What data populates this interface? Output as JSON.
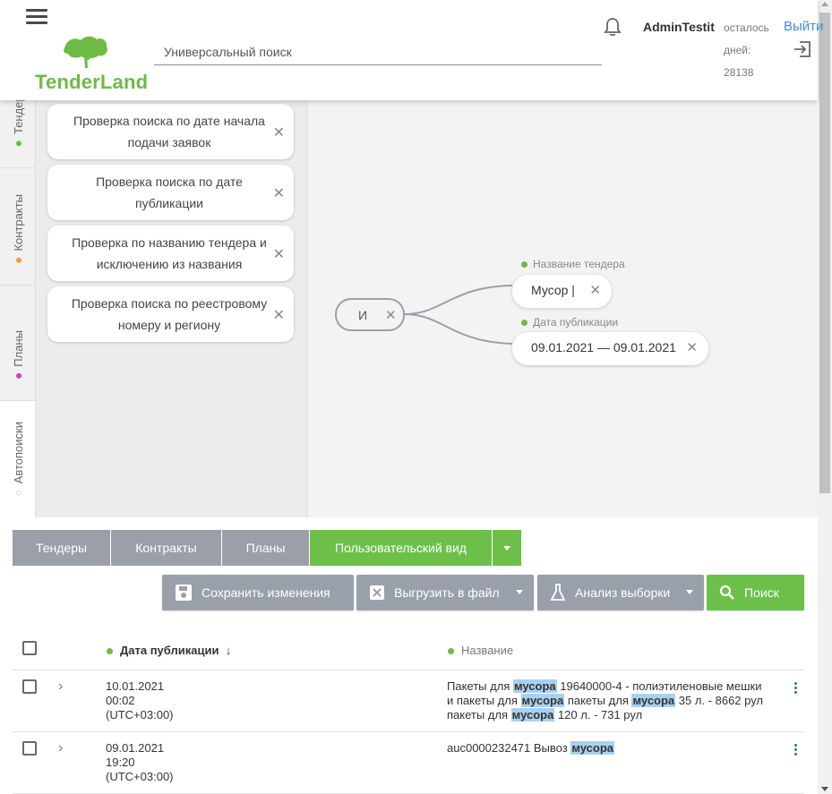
{
  "header": {
    "brand": "TenderLand",
    "search_placeholder": "Универсальный поиск",
    "username": "AdminTestit",
    "days_left_label": "осталось дней:",
    "days_left_value": "28138",
    "logout_label": "Выйти",
    "colors": {
      "brand": "#6dbb45",
      "link": "#3a8dde"
    }
  },
  "side_tabs": [
    {
      "label": "Тендеры",
      "dot_color": "#6dbb45"
    },
    {
      "label": "Контракты",
      "dot_color": "#f39a2a"
    },
    {
      "label": "Планы",
      "dot_color": "#d63cc8"
    },
    {
      "label": "Автопоиски",
      "dot_color": "#ffffff"
    }
  ],
  "saved_searches": [
    {
      "label": "Проверка поиска по дате начала подачи заявок"
    },
    {
      "label": "Проверка поиска по дате публикации"
    },
    {
      "label": "Проверка по названию тендера и исключению из названия"
    },
    {
      "label": "Проверка поиска по реестровому номеру и региону"
    }
  ],
  "query": {
    "operator": "И",
    "conditions": [
      {
        "field": "Название тендера",
        "value": "Мусор |"
      },
      {
        "field": "Дата публикации",
        "value": "09.01.2021 — 09.01.2021"
      }
    ]
  },
  "view_tabs": [
    "Тендеры",
    "Контракты",
    "Планы",
    "Пользовательский вид"
  ],
  "actions": {
    "save": "Сохранить изменения",
    "export": "Выгрузить в файл",
    "analyze": "Анализ выборки",
    "search": "Поиск"
  },
  "table": {
    "columns": {
      "date": "Дата публикации",
      "date_sort": "↓",
      "title": "Название"
    },
    "rows": [
      {
        "date": "10.01.2021\n00:02\n(UTC+03:00)",
        "title_parts": [
          {
            "t": "Пакеты для "
          },
          {
            "t": "мусора",
            "hl": true
          },
          {
            "t": " 19640000-4 - полиэтиленовые мешки и пакеты для "
          },
          {
            "t": "мусора",
            "hl": true
          },
          {
            "t": " пакеты для "
          },
          {
            "t": "мусора",
            "hl": true
          },
          {
            "t": " 35 л. - 8662 рул пакеты для "
          },
          {
            "t": "мусора",
            "hl": true
          },
          {
            "t": " 120 л. - 731 рул"
          }
        ]
      },
      {
        "date": "09.01.2021\n19:20\n(UTC+03:00)",
        "title_parts": [
          {
            "t": "auc0000232471 Вывоз "
          },
          {
            "t": "мусора",
            "hl": true
          }
        ]
      }
    ]
  }
}
